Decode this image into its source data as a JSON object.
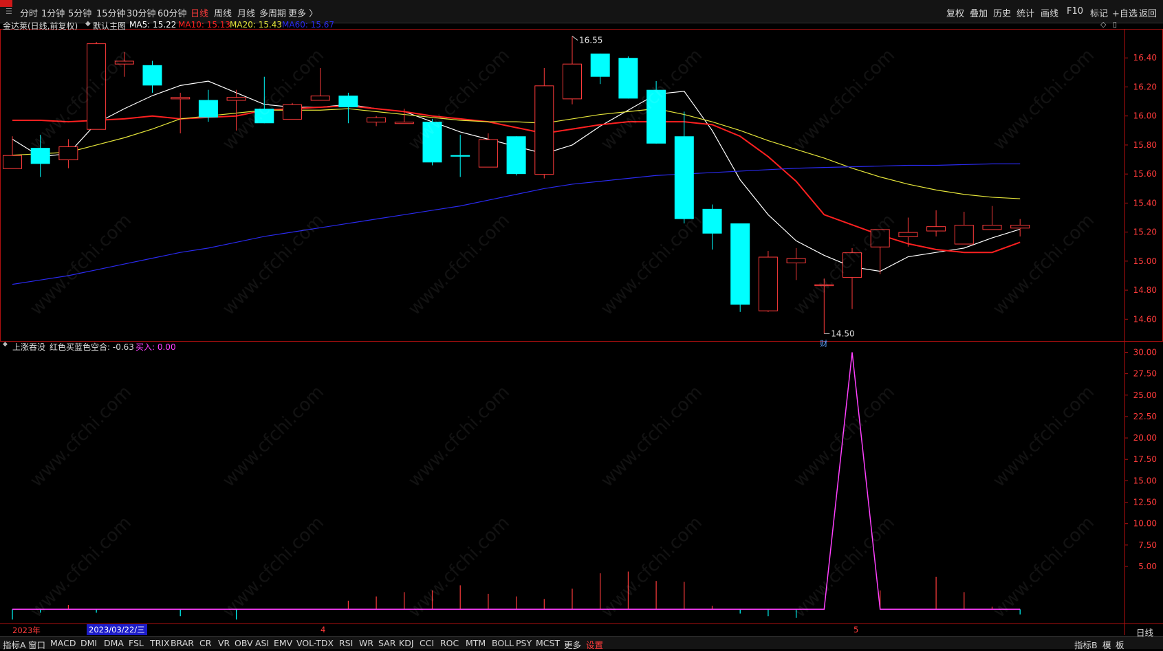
{
  "topbar": {
    "periods": [
      "分时",
      "1分钟",
      "5分钟",
      "15分钟",
      "30分钟",
      "60分钟",
      "日线",
      "周线",
      "月线",
      "多周期",
      "更多 〉"
    ],
    "active_period": "日线",
    "tools": [
      "复权",
      "叠加",
      "历史",
      "统计",
      "画线",
      "F10",
      "标记",
      "+自选",
      "返回"
    ]
  },
  "main_panel": {
    "title": "金达莱(日线,前复权)",
    "indicator_label": "默认主图",
    "ma": [
      {
        "label": "MA5: 15.22",
        "color": "#ffffff"
      },
      {
        "label": "MA10: 15.13",
        "color": "#ff2020"
      },
      {
        "label": "MA20: 15.43",
        "color": "#e5e53a"
      },
      {
        "label": "MA60: 15.67",
        "color": "#2a2af0"
      }
    ],
    "high_label": "16.55",
    "low_label": "14.50",
    "marker_label": "财"
  },
  "sub_panel": {
    "title": "上涨吞没",
    "series_label": "红色买蓝色空合: -0.63",
    "buy_label": "买入: 0.00"
  },
  "dates": {
    "year_label": "2023年",
    "cursor_date": "2023/03/22/三",
    "month_4": "4",
    "month_5": "5"
  },
  "bottombar": {
    "items": [
      "指标A",
      "窗口",
      "MACD",
      "DMI",
      "DMA",
      "FSL",
      "TRIX",
      "BRAR",
      "CR",
      "VR",
      "OBV",
      "ASI",
      "EMV",
      "VOL-TDX",
      "RSI",
      "WR",
      "SAR",
      "KDJ",
      "CCI",
      "ROC",
      "MTM",
      "BOLL",
      "PSY",
      "MCST",
      "更多",
      "设置"
    ],
    "active": "设置",
    "right_items": [
      "指标B",
      "模",
      "板"
    ],
    "right_period": "日线"
  },
  "watermark": "www.cfchi.com",
  "chart_data": [
    {
      "type": "candlestick",
      "title": "金达莱(日线,前复权)",
      "ylim": [
        14.45,
        16.6
      ],
      "yticks": [
        14.6,
        14.8,
        15.0,
        15.2,
        15.4,
        15.6,
        15.8,
        16.0,
        16.2,
        16.4
      ],
      "up_color": "#ff3b3b",
      "down_color": "#00ffff",
      "candles": [
        {
          "o": 15.64,
          "h": 15.86,
          "l": 15.64,
          "c": 15.73
        },
        {
          "o": 15.78,
          "h": 15.87,
          "l": 15.58,
          "c": 15.67
        },
        {
          "o": 15.7,
          "h": 15.84,
          "l": 15.64,
          "c": 15.79
        },
        {
          "o": 15.91,
          "h": 16.51,
          "l": 15.91,
          "c": 16.5
        },
        {
          "o": 16.36,
          "h": 16.44,
          "l": 16.27,
          "c": 16.38
        },
        {
          "o": 16.35,
          "h": 16.38,
          "l": 16.16,
          "c": 16.21
        },
        {
          "o": 16.12,
          "h": 16.16,
          "l": 15.88,
          "c": 16.13
        },
        {
          "o": 16.11,
          "h": 16.18,
          "l": 15.96,
          "c": 15.99
        },
        {
          "o": 16.11,
          "h": 16.18,
          "l": 15.9,
          "c": 16.13
        },
        {
          "o": 16.05,
          "h": 16.27,
          "l": 15.95,
          "c": 15.95
        },
        {
          "o": 15.98,
          "h": 16.09,
          "l": 15.98,
          "c": 16.08
        },
        {
          "o": 16.11,
          "h": 16.33,
          "l": 16.11,
          "c": 16.14
        },
        {
          "o": 16.14,
          "h": 16.16,
          "l": 15.95,
          "c": 16.06
        },
        {
          "o": 15.96,
          "h": 16.0,
          "l": 15.93,
          "c": 15.99
        },
        {
          "o": 15.95,
          "h": 16.05,
          "l": 15.95,
          "c": 15.96
        },
        {
          "o": 15.96,
          "h": 15.98,
          "l": 15.66,
          "c": 15.68
        },
        {
          "o": 15.73,
          "h": 15.87,
          "l": 15.58,
          "c": 15.72
        },
        {
          "o": 15.65,
          "h": 15.88,
          "l": 15.65,
          "c": 15.84
        },
        {
          "o": 15.86,
          "h": 15.86,
          "l": 15.59,
          "c": 15.6
        },
        {
          "o": 15.6,
          "h": 16.33,
          "l": 15.57,
          "c": 16.21
        },
        {
          "o": 16.12,
          "h": 16.55,
          "l": 16.08,
          "c": 16.36
        },
        {
          "o": 16.43,
          "h": 16.43,
          "l": 16.22,
          "c": 16.27
        },
        {
          "o": 16.4,
          "h": 16.41,
          "l": 16.12,
          "c": 16.12
        },
        {
          "o": 16.18,
          "h": 16.24,
          "l": 15.81,
          "c": 15.81
        },
        {
          "o": 15.86,
          "h": 16.03,
          "l": 15.26,
          "c": 15.29
        },
        {
          "o": 15.36,
          "h": 15.39,
          "l": 15.08,
          "c": 15.19
        },
        {
          "o": 15.26,
          "h": 15.26,
          "l": 14.65,
          "c": 14.7
        },
        {
          "o": 14.66,
          "h": 15.07,
          "l": 14.65,
          "c": 15.03
        },
        {
          "o": 14.99,
          "h": 15.09,
          "l": 14.87,
          "c": 15.02
        },
        {
          "o": 14.84,
          "h": 14.88,
          "l": 14.5,
          "c": 14.84
        },
        {
          "o": 14.89,
          "h": 15.09,
          "l": 14.67,
          "c": 15.06
        },
        {
          "o": 15.1,
          "h": 15.22,
          "l": 14.91,
          "c": 15.22
        },
        {
          "o": 15.17,
          "h": 15.3,
          "l": 15.1,
          "c": 15.2
        },
        {
          "o": 15.21,
          "h": 15.35,
          "l": 15.17,
          "c": 15.24
        },
        {
          "o": 15.12,
          "h": 15.34,
          "l": 15.12,
          "c": 15.25
        },
        {
          "o": 15.22,
          "h": 15.38,
          "l": 15.22,
          "c": 15.25
        },
        {
          "o": 15.23,
          "h": 15.29,
          "l": 15.17,
          "c": 15.25
        }
      ],
      "ma_lines": [
        {
          "name": "MA5",
          "color": "#ffffff",
          "values": [
            15.84,
            15.72,
            15.74,
            15.95,
            16.05,
            16.14,
            16.21,
            16.24,
            16.16,
            16.08,
            16.06,
            16.06,
            16.08,
            16.05,
            16.03,
            15.96,
            15.89,
            15.84,
            15.79,
            15.74,
            15.8,
            15.93,
            16.04,
            16.15,
            16.17,
            15.9,
            15.56,
            15.32,
            15.14,
            15.04,
            14.96,
            14.93,
            15.03,
            15.06,
            15.09,
            15.16,
            15.22
          ]
        },
        {
          "name": "MA10",
          "color": "#ff2020",
          "values": [
            15.97,
            15.97,
            15.96,
            15.97,
            15.98,
            16.0,
            15.98,
            15.99,
            16.0,
            16.04,
            16.05,
            16.06,
            16.07,
            16.05,
            16.03,
            16.0,
            15.98,
            15.96,
            15.92,
            15.88,
            15.91,
            15.94,
            15.96,
            15.96,
            15.96,
            15.94,
            15.86,
            15.72,
            15.55,
            15.32,
            15.25,
            15.18,
            15.12,
            15.08,
            15.06,
            15.06,
            15.13
          ]
        },
        {
          "name": "MA20",
          "color": "#e5e53a",
          "values": [
            15.73,
            15.74,
            15.75,
            15.8,
            15.85,
            15.91,
            15.98,
            16.0,
            16.02,
            16.04,
            16.04,
            16.04,
            16.05,
            16.03,
            16.01,
            15.99,
            15.97,
            15.96,
            15.96,
            15.95,
            15.98,
            16.01,
            16.03,
            16.05,
            16.01,
            15.96,
            15.9,
            15.83,
            15.77,
            15.71,
            15.64,
            15.58,
            15.53,
            15.49,
            15.46,
            15.44,
            15.43
          ]
        },
        {
          "name": "MA60",
          "color": "#2a2af0",
          "values": [
            14.84,
            14.87,
            14.9,
            14.94,
            14.98,
            15.02,
            15.06,
            15.09,
            15.13,
            15.17,
            15.2,
            15.23,
            15.26,
            15.29,
            15.32,
            15.35,
            15.38,
            15.42,
            15.46,
            15.5,
            15.53,
            15.55,
            15.57,
            15.59,
            15.6,
            15.61,
            15.62,
            15.63,
            15.64,
            15.645,
            15.65,
            15.655,
            15.66,
            15.66,
            15.665,
            15.67,
            15.67
          ]
        }
      ],
      "annotations": [
        {
          "text": "16.55",
          "value": 16.55
        },
        {
          "text": "14.50",
          "value": 14.5
        }
      ]
    },
    {
      "type": "line",
      "title": "上涨吞没",
      "ylim": [
        -1.5,
        31
      ],
      "yticks": [
        5.0,
        7.5,
        10.0,
        12.5,
        15.0,
        17.5,
        20.0,
        22.5,
        25.0,
        27.5,
        30.0
      ],
      "series": [
        {
          "name": "红色买蓝色空合",
          "color": "#ff40ff",
          "values": [
            0,
            0,
            0,
            0,
            0,
            0,
            0,
            0,
            0,
            0,
            0,
            0,
            0,
            0,
            0,
            0,
            0,
            0,
            0,
            0,
            0,
            0,
            0,
            0,
            0,
            0,
            0,
            0,
            0,
            0,
            30,
            0,
            0,
            0,
            0,
            0,
            0
          ]
        }
      ],
      "bars": [
        -1.2,
        -0.4,
        0.5,
        -0.4,
        0,
        0,
        -0.8,
        0,
        -1.2,
        0,
        0,
        0,
        1.0,
        1.5,
        2.0,
        2.2,
        2.8,
        1.8,
        1.5,
        1.2,
        2.4,
        4.2,
        4.4,
        3.3,
        3.2,
        0.4,
        -0.5,
        -0.8,
        -1.0,
        0,
        0,
        2.2,
        0,
        3.8,
        2.0,
        0.3,
        -0.6
      ]
    }
  ]
}
